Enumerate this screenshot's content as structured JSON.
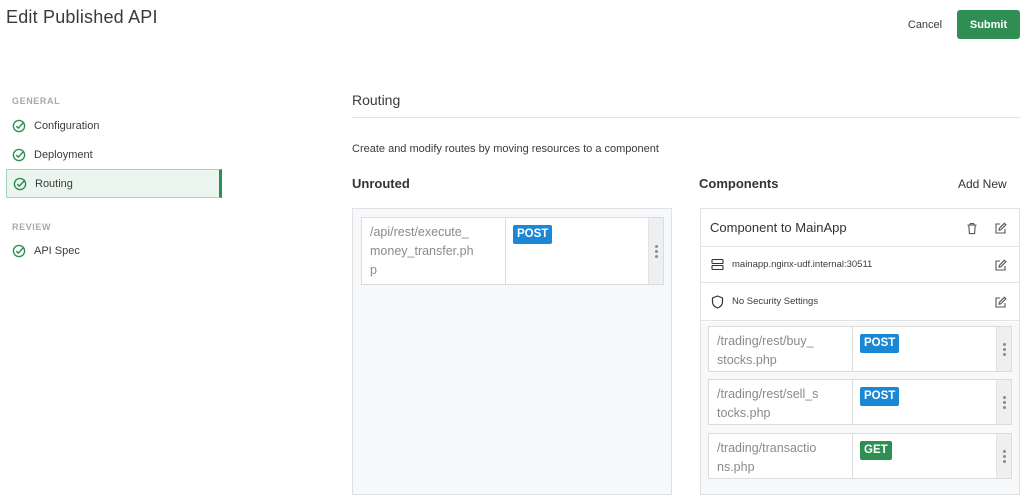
{
  "header": {
    "title": "Edit Published API",
    "cancel_label": "Cancel",
    "submit_label": "Submit",
    "accent_color": "#2f8f52"
  },
  "sidebar": {
    "general_label": "GENERAL",
    "review_label": "REVIEW",
    "items": [
      {
        "label": "Configuration",
        "icon": "check-circle-icon",
        "completed": true
      },
      {
        "label": "Deployment",
        "icon": "check-circle-icon",
        "completed": true
      },
      {
        "label": "Routing",
        "icon": "check-circle-icon",
        "completed": true,
        "active": true
      },
      {
        "label": "API Spec",
        "icon": "check-circle-icon",
        "completed": true
      }
    ]
  },
  "main": {
    "section_title": "Routing",
    "description": "Create and modify routes by moving resources to a component",
    "unrouted_label": "Unrouted",
    "components_label": "Components",
    "add_new_label": "Add New",
    "unrouted_routes": [
      {
        "path_lines": [
          "/api/rest/execute_",
          "money_transfer.ph",
          "p"
        ],
        "method": "POST"
      }
    ],
    "component": {
      "name": "Component to MainApp",
      "upstream": "mainapp.nginx-udf.internal:30511",
      "security": "No Security Settings",
      "routes": [
        {
          "path_lines": [
            "/trading/rest/buy_",
            "stocks.php"
          ],
          "method": "POST"
        },
        {
          "path_lines": [
            "/trading/rest/sell_s",
            "tocks.php"
          ],
          "method": "POST"
        },
        {
          "path_lines": [
            "/trading/transactio",
            "ns.php"
          ],
          "method": "GET"
        }
      ]
    }
  }
}
